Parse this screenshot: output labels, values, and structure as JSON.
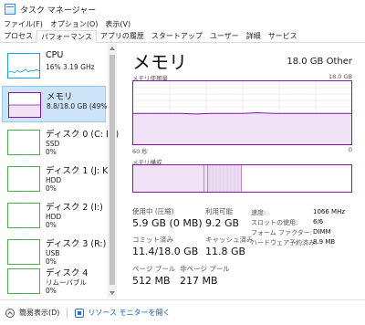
{
  "window": {
    "title": "タスク マネージャー"
  },
  "menu": [
    "ファイル(F)",
    "オプション(O)",
    "表示(V)"
  ],
  "tabs": [
    "プロセス",
    "パフォーマンス",
    "アプリの履歴",
    "スタートアップ",
    "ユーザー",
    "詳細",
    "サービス"
  ],
  "active_tab": "パフォーマンス",
  "sidebar": {
    "items": [
      {
        "name": "CPU",
        "line1": "16%  3.19 GHz",
        "line2": ""
      },
      {
        "name": "メモリ",
        "line1": "8.8/18.0 GB (49%)",
        "line2": ""
      },
      {
        "name": "ディスク 0 (C: D:)",
        "line1": "SSD",
        "line2": "0%"
      },
      {
        "name": "ディスク 1 (J: K:)",
        "line1": "HDD",
        "line2": "0%"
      },
      {
        "name": "ディスク 2 (I:)",
        "line1": "HDD",
        "line2": "0%"
      },
      {
        "name": "ディスク 3 (R:)",
        "line1": "USB",
        "line2": "0%"
      },
      {
        "name": "ディスク 4",
        "line1": "リムーバブル",
        "line2": "0%"
      }
    ]
  },
  "main": {
    "title": "メモリ",
    "total": "18.0 GB Other",
    "usage_label": "メモリ使用量",
    "usage_max": "18.0 GB",
    "time_label": "60 秒",
    "zero_label": "0",
    "composition_label": "メモリ構成",
    "stats": {
      "in_use_label": "使用中 (圧縮)",
      "in_use_value": "5.9 GB (0 MB)",
      "available_label": "利用可能",
      "available_value": "9.2 GB",
      "committed_label": "コミット済み",
      "committed_value": "11.4/18.0 GB",
      "cached_label": "キャッシュ済み",
      "cached_value": "11.8 GB",
      "paged_label": "ページ プール",
      "paged_value": "512 MB",
      "nonpaged_label": "非ページ プール",
      "nonpaged_value": "217 MB"
    },
    "specs": [
      {
        "label": "速度:",
        "value": "1066 MHz"
      },
      {
        "label": "スロットの使用:",
        "value": "6/6"
      },
      {
        "label": "フォーム ファクター:",
        "value": "DIMM"
      },
      {
        "label": "ハードウェア予約済み:",
        "value": "8.9 MB"
      }
    ]
  },
  "footer": {
    "fewer": "簡易表示(D)",
    "monitor": "リソース モニターを開く"
  },
  "colors": {
    "memory": "#8b12ae",
    "cpu": "#17a2dd",
    "disk": "#4cae4c"
  },
  "chart_data": {
    "type": "area",
    "usage_percent_series": [
      49,
      49,
      49,
      49,
      48,
      49,
      49,
      49,
      50,
      49,
      49,
      49,
      49,
      49,
      49
    ],
    "usage_max_gb": 18.0,
    "composition": {
      "in_use_gb": 5.9,
      "modified_gb": 0.2,
      "standby_gb": 2.9,
      "free_gb": 9.0
    }
  }
}
